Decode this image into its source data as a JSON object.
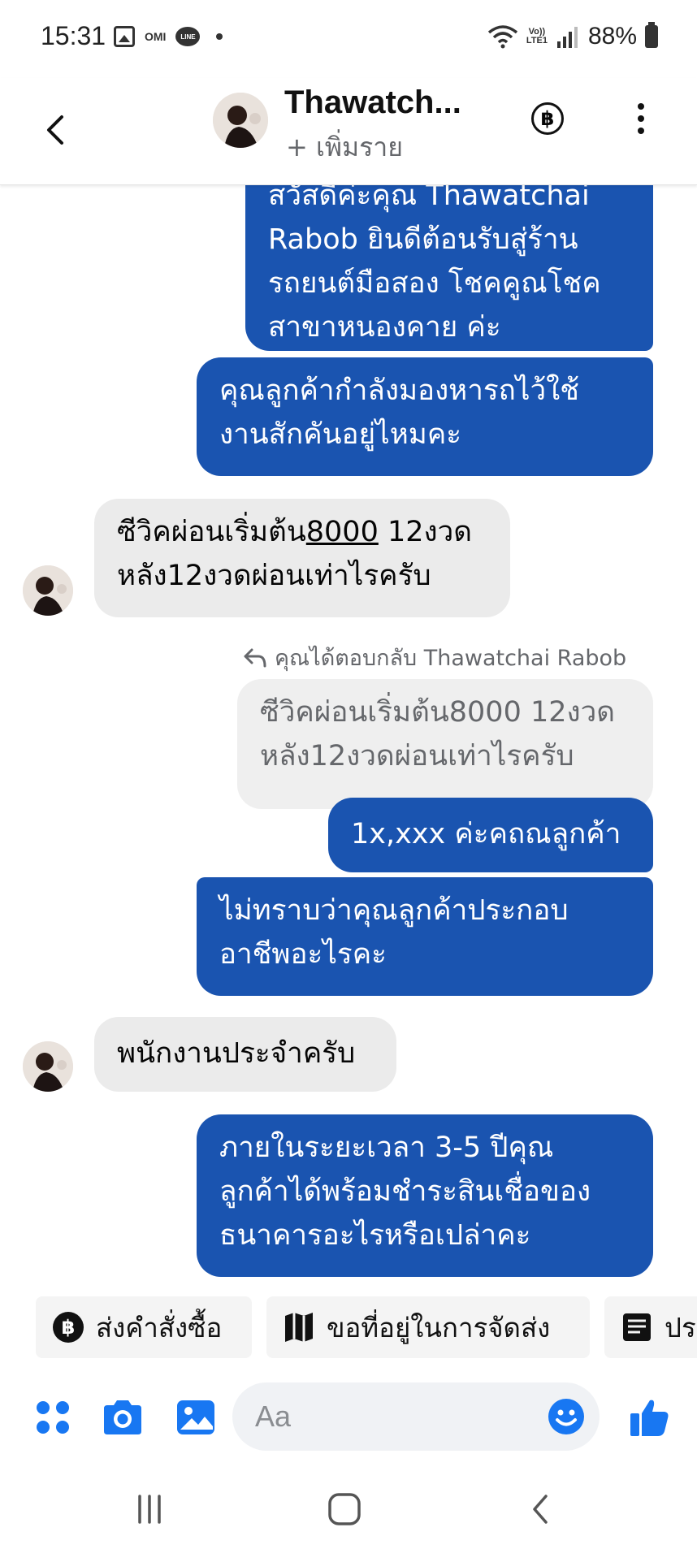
{
  "status_bar": {
    "time": "15:31",
    "omi": "OMI",
    "line": "LINE",
    "volte": [
      "Vo))",
      "LTE1"
    ],
    "battery": "88%"
  },
  "header": {
    "contact_name": "Thawatch...",
    "add_nickname": "+ เพิ่มราย",
    "baht_symbol": "฿"
  },
  "messages": [
    {
      "side": "outgoing",
      "lines": [
        "สวัสดีค่ะคุณ Thawatchai",
        "Rabob ยินดีต้อนรับสู่ร้าน",
        "รถยนต์มือสอง โชคคูณโชค",
        "สาขาหนองคาย ค่ะ"
      ]
    },
    {
      "side": "outgoing",
      "lines": [
        "คุณลูกค้ากำลังมองหารถไว้ใช้",
        "งานสักคันอยู่ไหมคะ"
      ]
    },
    {
      "side": "incoming",
      "pre": "ซีวิคผ่อนเริ่มต้น",
      "underlined": "8000",
      "post": " 12งวด",
      "line2": "หลัง12งวดผ่อนเท่าไรครับ"
    },
    {
      "reply_note": "คุณได้ตอบกลับ Thawatchai Rabob"
    },
    {
      "side": "quoted",
      "lines": [
        "ซีวิคผ่อนเริ่มต้น8000 12งวด",
        "หลัง12งวดผ่อนเท่าไรครับ"
      ]
    },
    {
      "side": "outgoing",
      "lines": [
        "1x,xxx ค่ะคถณลูกค้า"
      ]
    },
    {
      "side": "outgoing",
      "lines": [
        "ไม่ทราบว่าคุณลูกค้าประกอบ",
        "อาชีพอะไรคะ"
      ]
    },
    {
      "side": "incoming",
      "lines": [
        "พนักงานประจำครับ"
      ]
    },
    {
      "side": "outgoing",
      "lines": [
        "ภายในระยะเวลา 3-5 ปีคุณ",
        "ลูกค้าได้พร้อมชำระสินเชื่อของ",
        "ธนาคารอะไรหรือเปล่าคะ"
      ]
    }
  ],
  "quick_replies": [
    "ส่งคำสั่งซื้อ",
    "ขอที่อยู่ในการจัดส่ง",
    "ปร"
  ],
  "composer": {
    "placeholder": "Aa"
  },
  "colors": {
    "outgoing_bubble": "#1a54b0",
    "incoming_bubble": "#ebebeb",
    "accent": "#1877f2"
  },
  "icons": [
    "back-arrow-icon",
    "baht-icon",
    "more-icon",
    "reply-icon",
    "map-icon",
    "document-icon",
    "apps-icon",
    "camera-icon",
    "gallery-icon",
    "emoji-icon",
    "like-icon",
    "recents-icon",
    "home-icon",
    "nav-back-icon"
  ]
}
